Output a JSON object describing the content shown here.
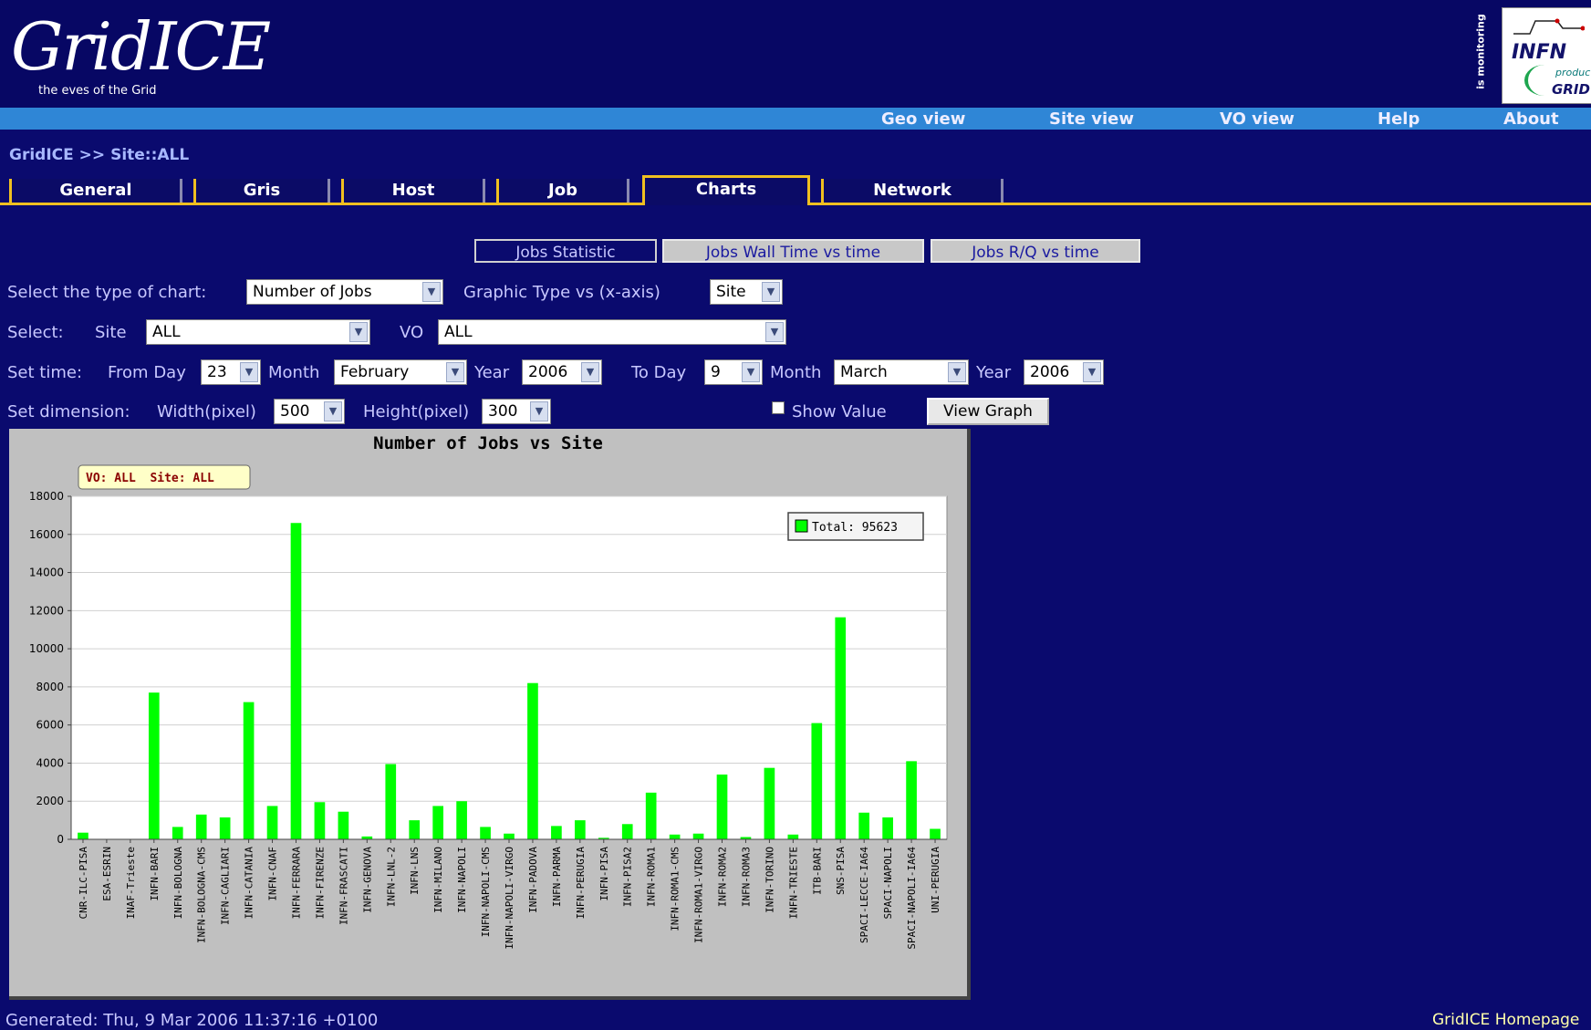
{
  "header": {
    "logo_text": "GridICE",
    "tagline": "the eves of the Grid",
    "monitoring_label": "is monitoring",
    "infn_logo": {
      "title": "INFN",
      "sub1": "production",
      "sub2": "GRID"
    }
  },
  "topnav": [
    "Geo view",
    "Site view",
    "VO view",
    "Help",
    "About"
  ],
  "breadcrumb": "GridICE >> Site::ALL",
  "tabs": [
    {
      "label": "General",
      "active": false
    },
    {
      "label": "Gris",
      "active": false
    },
    {
      "label": "Host",
      "active": false
    },
    {
      "label": "Job",
      "active": false
    },
    {
      "label": "Charts",
      "active": true
    },
    {
      "label": "Network",
      "active": false
    }
  ],
  "subtabs": [
    {
      "label": "Jobs Statistic",
      "active": true
    },
    {
      "label": "Jobs Wall Time vs time",
      "active": false
    },
    {
      "label": "Jobs R/Q vs time",
      "active": false
    }
  ],
  "form": {
    "chart_type_label": "Select the type of chart:",
    "chart_type_value": "Number of Jobs",
    "graphic_type_label": "Graphic Type vs (x-axis)",
    "graphic_type_value": "Site",
    "select_label": "Select:",
    "site_label": "Site",
    "site_value": "ALL",
    "vo_label": "VO",
    "vo_value": "ALL",
    "set_time_label": "Set time:",
    "from_day_label": "From Day",
    "from_day_value": "23",
    "from_month_label": "Month",
    "from_month_value": "February",
    "from_year_label": "Year",
    "from_year_value": "2006",
    "to_day_label": "To Day",
    "to_day_value": "9",
    "to_month_label": "Month",
    "to_month_value": "March",
    "to_year_label": "Year",
    "to_year_value": "2006",
    "dimension_label": "Set dimension:",
    "width_label": "Width(pixel)",
    "width_value": "500",
    "height_label": "Height(pixel)",
    "height_value": "300",
    "show_value_label": "Show Value",
    "show_value_checked": false,
    "view_graph_label": "View Graph"
  },
  "chart_data": {
    "type": "bar",
    "title": "Number of Jobs vs Site",
    "filter_label": "VO: ALL  Site: ALL",
    "legend": "Total: 95623",
    "legend_position": "top-right",
    "bar_color": "#00ff00",
    "ylim": [
      0,
      18000
    ],
    "yticks": [
      "0",
      "2000",
      "4000",
      "6000",
      "8000",
      "10000",
      "12000",
      "14000",
      "16000",
      "18000"
    ],
    "categories": [
      "CNR-ILC-PISA",
      "ESA-ESRIN",
      "INAF-Trieste",
      "INFN-BARI",
      "INFN-BOLOGNA",
      "INFN-BOLOGNA-CMS",
      "INFN-CAGLIARI",
      "INFN-CATANIA",
      "INFN-CNAF",
      "INFN-FERRARA",
      "INFN-FIRENZE",
      "INFN-FRASCATI",
      "INFN-GENOVA",
      "INFN-LNL-2",
      "INFN-LNS",
      "INFN-MILANO",
      "INFN-NAPOLI",
      "INFN-NAPOLI-CMS",
      "INFN-NAPOLI-VIRGO",
      "INFN-PADOVA",
      "INFN-PARMA",
      "INFN-PERUGIA",
      "INFN-PISA",
      "INFN-PISA2",
      "INFN-ROMA1",
      "INFN-ROMA1-CMS",
      "INFN-ROMA1-VIRGO",
      "INFN-ROMA2",
      "INFN-ROMA3",
      "INFN-TORINO",
      "INFN-TRIESTE",
      "ITB-BARI",
      "SNS-PISA",
      "SPACI-LECCE-IA64",
      "SPACI-NAPOLI",
      "SPACI-NAPOLI-IA64",
      "UNI-PERUGIA"
    ],
    "values": [
      350,
      0,
      0,
      7700,
      650,
      1300,
      1150,
      7200,
      1750,
      16600,
      1950,
      1450,
      150,
      3950,
      1000,
      1750,
      2000,
      650,
      300,
      8200,
      700,
      1000,
      80,
      800,
      2450,
      250,
      300,
      3400,
      120,
      3750,
      250,
      6100,
      11650,
      1400,
      1150,
      4100,
      550
    ]
  },
  "footer": {
    "generated": "Generated: Thu, 9 Mar 2006 11:37:16 +0100",
    "homepage": "GridICE Homepage"
  }
}
